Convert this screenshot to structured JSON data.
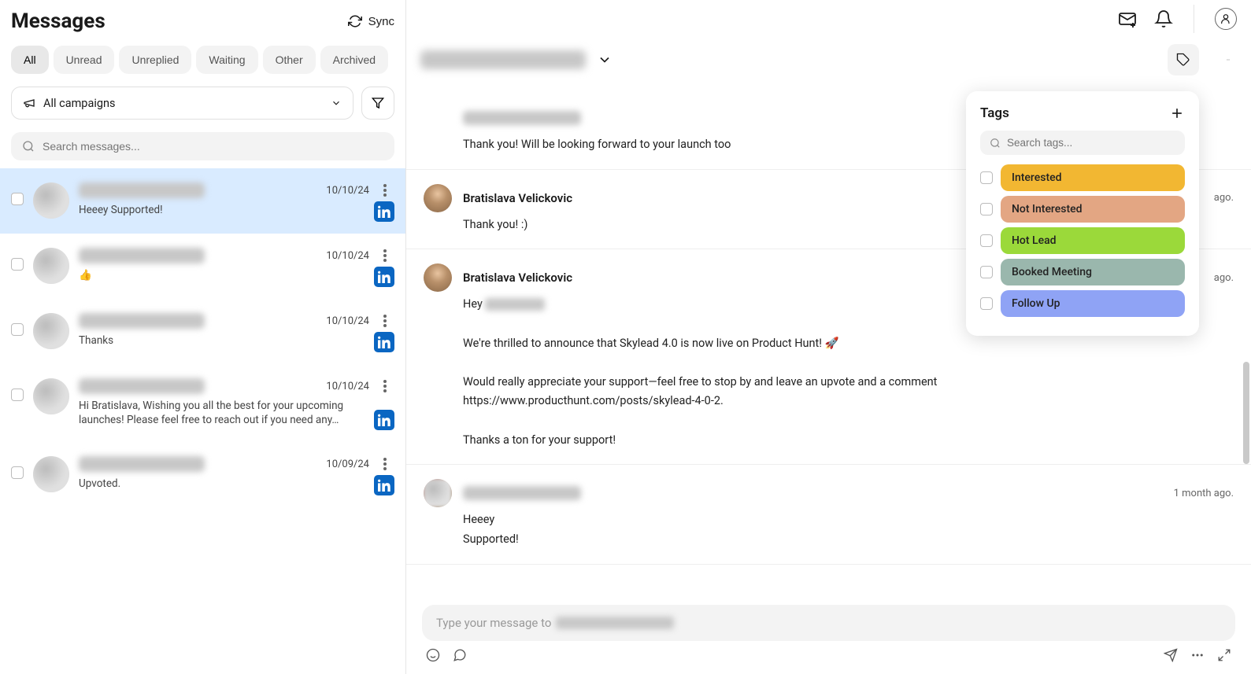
{
  "header": {
    "title": "Messages",
    "sync_label": "Sync"
  },
  "tabs": [
    "All",
    "Unread",
    "Unreplied",
    "Waiting",
    "Other",
    "Archived"
  ],
  "active_tab_index": 0,
  "campaign_filter_label": "All campaigns",
  "search_placeholder": "Search messages...",
  "conversations": [
    {
      "date": "10/10/24",
      "preview": "Heeey Supported!",
      "selected": true
    },
    {
      "date": "10/10/24",
      "preview": "👍",
      "selected": false
    },
    {
      "date": "10/10/24",
      "preview": "Thanks",
      "selected": false
    },
    {
      "date": "10/10/24",
      "preview": "Hi Bratislava, Wishing you all the best for your upcoming launches! Please feel free to reach out if you need any…",
      "selected": false
    },
    {
      "date": "10/09/24",
      "preview": "Upvoted.",
      "selected": false
    }
  ],
  "thread": [
    {
      "sender": "",
      "blurred_sender": true,
      "time": "",
      "text": "Thank you! Will be looking forward to your launch too",
      "avatar": false
    },
    {
      "sender": "Bratislava Velickovic",
      "blurred_sender": false,
      "time": "ago.",
      "text": "Thank you! :)",
      "avatar": true
    },
    {
      "sender": "Bratislava Velickovic",
      "blurred_sender": false,
      "time": "ago.",
      "text_prefix": "Hey ",
      "text_body": "We're thrilled to announce that Skylead 4.0 is now live on Product Hunt! 🚀\n\nWould really appreciate your support—feel free to stop by and leave an upvote and a comment\nhttps://www.producthunt.com/posts/skylead-4-0-2.\n\nThanks a ton for your support!",
      "avatar": true,
      "has_inline_blur": true
    },
    {
      "sender": "",
      "blurred_sender": true,
      "time": "1 month ago.",
      "text": "Heeey\nSupported!",
      "avatar": true
    }
  ],
  "composer_placeholder_prefix": "Type your message to ",
  "tags_popover": {
    "title": "Tags",
    "search_placeholder": "Search tags...",
    "tags": [
      {
        "label": "Interested",
        "color": "#f2b732"
      },
      {
        "label": "Not Interested",
        "color": "#e3a683"
      },
      {
        "label": "Hot Lead",
        "color": "#9bd93a"
      },
      {
        "label": "Booked Meeting",
        "color": "#9ab7ad"
      },
      {
        "label": "Follow Up",
        "color": "#8fa3f5"
      }
    ]
  }
}
